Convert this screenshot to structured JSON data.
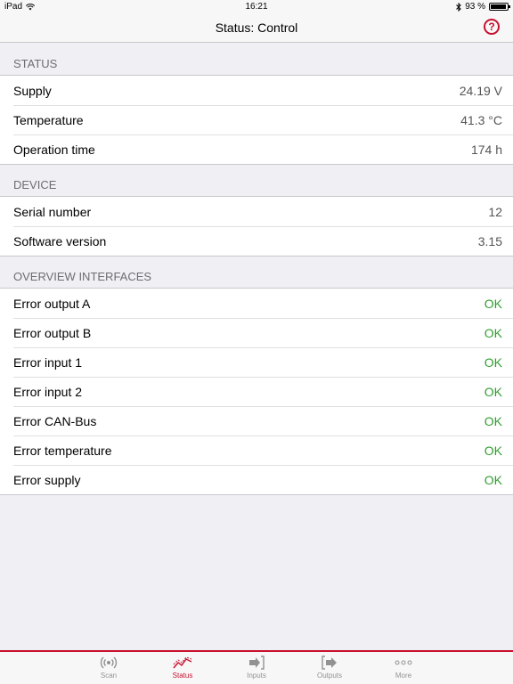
{
  "statusbar": {
    "device": "iPad",
    "time": "16:21",
    "battery_text": "93 %",
    "battery_level": 0.93
  },
  "navbar": {
    "title": "Status: Control",
    "help_glyph": "?"
  },
  "sections": [
    {
      "header": "STATUS",
      "rows": [
        {
          "label": "Supply",
          "value": "24.19 V"
        },
        {
          "label": "Temperature",
          "value": "41.3 °C"
        },
        {
          "label": "Operation time",
          "value": "174 h"
        }
      ]
    },
    {
      "header": "DEVICE",
      "rows": [
        {
          "label": "Serial number",
          "value": "12"
        },
        {
          "label": "Software version",
          "value": "3.15"
        }
      ]
    },
    {
      "header": "OVERVIEW INTERFACES",
      "rows": [
        {
          "label": "Error output A",
          "value": "OK"
        },
        {
          "label": "Error output B",
          "value": "OK"
        },
        {
          "label": "Error input 1",
          "value": "OK"
        },
        {
          "label": "Error input 2",
          "value": "OK"
        },
        {
          "label": "Error CAN-Bus",
          "value": "OK"
        },
        {
          "label": "Error temperature",
          "value": "OK"
        },
        {
          "label": "Error supply",
          "value": "OK"
        }
      ]
    }
  ],
  "tabs": [
    {
      "label": "Scan",
      "icon": "broadcast-icon"
    },
    {
      "label": "Status",
      "icon": "chart-line-icon"
    },
    {
      "label": "Inputs",
      "icon": "input-arrow-icon"
    },
    {
      "label": "Outputs",
      "icon": "output-arrow-icon"
    },
    {
      "label": "More",
      "icon": "more-dots-icon"
    }
  ],
  "active_tab": "Status",
  "colors": {
    "accent": "#c8102e",
    "ok": "#2e9e2e"
  }
}
